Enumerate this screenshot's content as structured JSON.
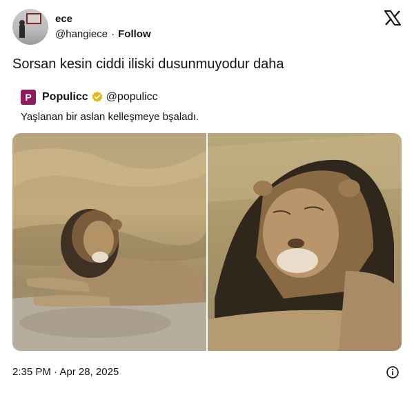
{
  "author": {
    "display_name": "ece",
    "handle": "@hangiece",
    "separator": "·",
    "follow_label": "Follow"
  },
  "tweet": {
    "text": "Sorsan kesin ciddi iliski dusunmuyodur daha",
    "timestamp": "2:35 PM · Apr 28, 2025"
  },
  "quoted": {
    "logo_letter": "P",
    "name": "Populicc",
    "handle": "@populicc",
    "text": "Yaşlanan bir aslan kelleşmeye bşaladı.",
    "verified": true
  },
  "media": [
    {
      "icon": "lion-resting-photo"
    },
    {
      "icon": "lion-closeup-photo"
    }
  ],
  "colors": {
    "text": "#0f1419",
    "brand_logo": "#8b1a5e",
    "verified_badge": "#e2b719",
    "background": "#ffffff"
  }
}
